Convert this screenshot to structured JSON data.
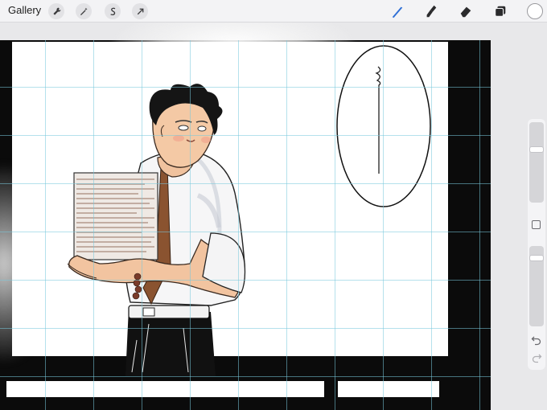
{
  "toolbar": {
    "gallery_label": "Gallery",
    "left_icons": [
      "wrench-icon",
      "magic-wand-icon",
      "selection-s-icon",
      "transform-arrow-icon"
    ],
    "right_tools": [
      "brush-icon",
      "smudge-icon",
      "eraser-icon",
      "layers-icon"
    ],
    "active_tool": "brush-icon",
    "active_color": "#2f6fd6",
    "current_color": "#ffffff"
  },
  "canvas": {
    "speech_bubble_text": "",
    "background_color": "#0b0b0b",
    "panel_color": "#ffffff",
    "grid_color": "#7cc8dc"
  },
  "sidebar": {
    "brush_size": 0.7,
    "opacity": 0.9,
    "icons": [
      "modify-square-icon",
      "undo-icon",
      "redo-icon"
    ]
  }
}
